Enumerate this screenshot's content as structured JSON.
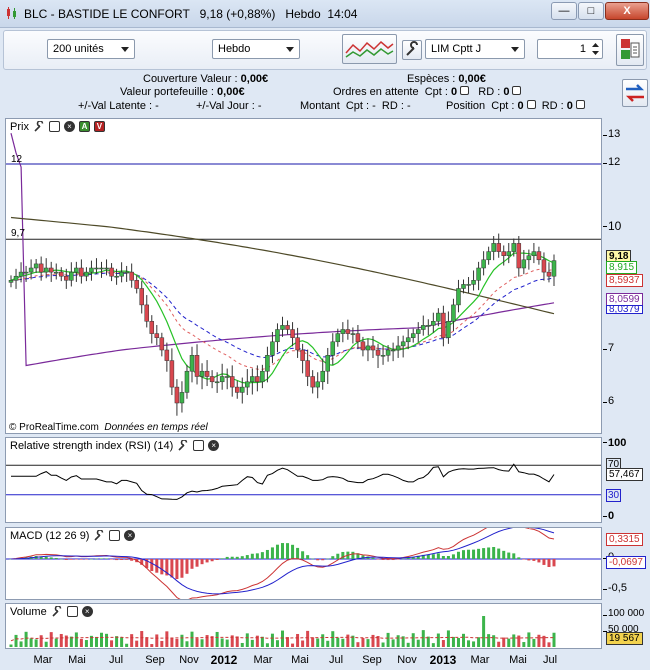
{
  "window": {
    "title": "BLC - BASTIDE LE CONFORT",
    "last": "9,18 (+0,88%)",
    "period": "Hebdo",
    "time": "14:04",
    "btn_min": "—",
    "btn_max": "□",
    "btn_close": "X"
  },
  "toolbar": {
    "units": "200 unités",
    "period": "Hebdo",
    "order_type": "LIM Cptt J",
    "quantity": "1"
  },
  "info": {
    "couverture_label": "Couverture Valeur :",
    "couverture_value": "0,00€",
    "especes_label": "Espèces :",
    "especes_value": "0,00€",
    "portefeuille_label": "Valeur portefeuille :",
    "portefeuille_value": "0,00€",
    "ordres_label": "Ordres en attente  Cpt :",
    "ordres_value": "0",
    "ordres_rd_label": "RD :",
    "ordres_rd_value": "0",
    "latente_label": "+/-Val Latente : -",
    "jour_label": "+/-Val Jour : -",
    "montant_label": "Montant  Cpt : -  RD : -",
    "position_label": "Position  Cpt :",
    "position_value": "0",
    "position_rd_label": "RD :",
    "position_rd_value": "0"
  },
  "price_panel": {
    "title": "Prix",
    "line12_label": "12",
    "line97_label": "9,7",
    "credit": "© ProRealTime.com",
    "credit_note": "Données en temps réel",
    "y_labels": [
      "13",
      "12",
      "10",
      "7",
      "6"
    ],
    "last_price": "9,18",
    "ma1": "8,915",
    "ma2": "8,5937",
    "ma3": "8,0599",
    "ma4": "8,0379",
    "colors": {
      "up": "#3cb44b",
      "down": "#d9474f",
      "green_ma": "#27c227",
      "purple_ma": "#7a2a9a",
      "olive_ma": "#4e4a28",
      "blue_ma": "#2222cc",
      "red_ma": "#e06060",
      "hline": "#1515a8"
    }
  },
  "rsi_panel": {
    "title": "Relative strength index (RSI) (14)",
    "y_labels": [
      "100",
      "70",
      "30",
      "0"
    ],
    "last": "57,467",
    "upper": "70",
    "lower": "30"
  },
  "macd_panel": {
    "title": "MACD (12 26 9)",
    "y_labels": [
      "0",
      "-0,5"
    ],
    "macd_last": "0,3315",
    "hist_last": "-0,0697"
  },
  "volume_panel": {
    "title": "Volume",
    "y_labels": [
      "100 000",
      "50 000"
    ],
    "last": "19 567"
  },
  "x_labels": [
    {
      "t": "Mar",
      "b": false
    },
    {
      "t": "Mai",
      "b": false
    },
    {
      "t": "Jul",
      "b": false
    },
    {
      "t": "Sep",
      "b": false
    },
    {
      "t": "Nov",
      "b": false
    },
    {
      "t": "2012",
      "b": true
    },
    {
      "t": "Mar",
      "b": false
    },
    {
      "t": "Mai",
      "b": false
    },
    {
      "t": "Jul",
      "b": false
    },
    {
      "t": "Sep",
      "b": false
    },
    {
      "t": "Nov",
      "b": false
    },
    {
      "t": "2013",
      "b": true
    },
    {
      "t": "Mar",
      "b": false
    },
    {
      "t": "Mai",
      "b": false
    },
    {
      "t": "Jul",
      "b": false
    }
  ],
  "chart_data": {
    "type": "candlestick",
    "title": "BLC - BASTIDE LE CONFORT",
    "timeframe": "Hebdo",
    "ylim": [
      5.7,
      13.6
    ],
    "hlines": [
      12,
      9.7
    ],
    "closes_approx": [
      8.7,
      8.8,
      8.9,
      8.9,
      9.0,
      9.1,
      8.9,
      9.0,
      8.9,
      8.9,
      8.8,
      8.7,
      8.9,
      9.0,
      8.8,
      8.9,
      9.0,
      9.0,
      9.0,
      9.0,
      8.8,
      8.8,
      8.9,
      8.9,
      8.7,
      8.5,
      8.1,
      7.7,
      7.4,
      7.3,
      7.0,
      6.8,
      6.3,
      6.0,
      6.2,
      6.6,
      6.9,
      6.5,
      6.6,
      6.5,
      6.4,
      6.4,
      6.5,
      6.5,
      6.3,
      6.2,
      6.3,
      6.4,
      6.5,
      6.4,
      6.6,
      6.9,
      7.2,
      7.5,
      7.6,
      7.5,
      7.3,
      7.0,
      6.8,
      6.5,
      6.3,
      6.4,
      6.6,
      6.9,
      7.2,
      7.4,
      7.5,
      7.4,
      7.4,
      7.2,
      7.0,
      7.1,
      7.0,
      6.9,
      6.9,
      7.0,
      7.0,
      7.1,
      7.2,
      7.3,
      7.4,
      7.5,
      7.6,
      7.6,
      7.7,
      7.9,
      7.3,
      7.7,
      8.1,
      8.5,
      8.6,
      8.6,
      8.7,
      9.0,
      9.2,
      9.4,
      9.6,
      9.4,
      9.3,
      9.4,
      9.6,
      9.0,
      9.2,
      9.3,
      9.4,
      9.2,
      8.9,
      8.8,
      9.18
    ],
    "series": [],
    "rsi": {
      "upper": 70,
      "lower": 30,
      "last": 57.467
    },
    "macd": {
      "last": 0.3315,
      "hist_last": -0.0697
    },
    "volume": {
      "last": 19567
    }
  }
}
